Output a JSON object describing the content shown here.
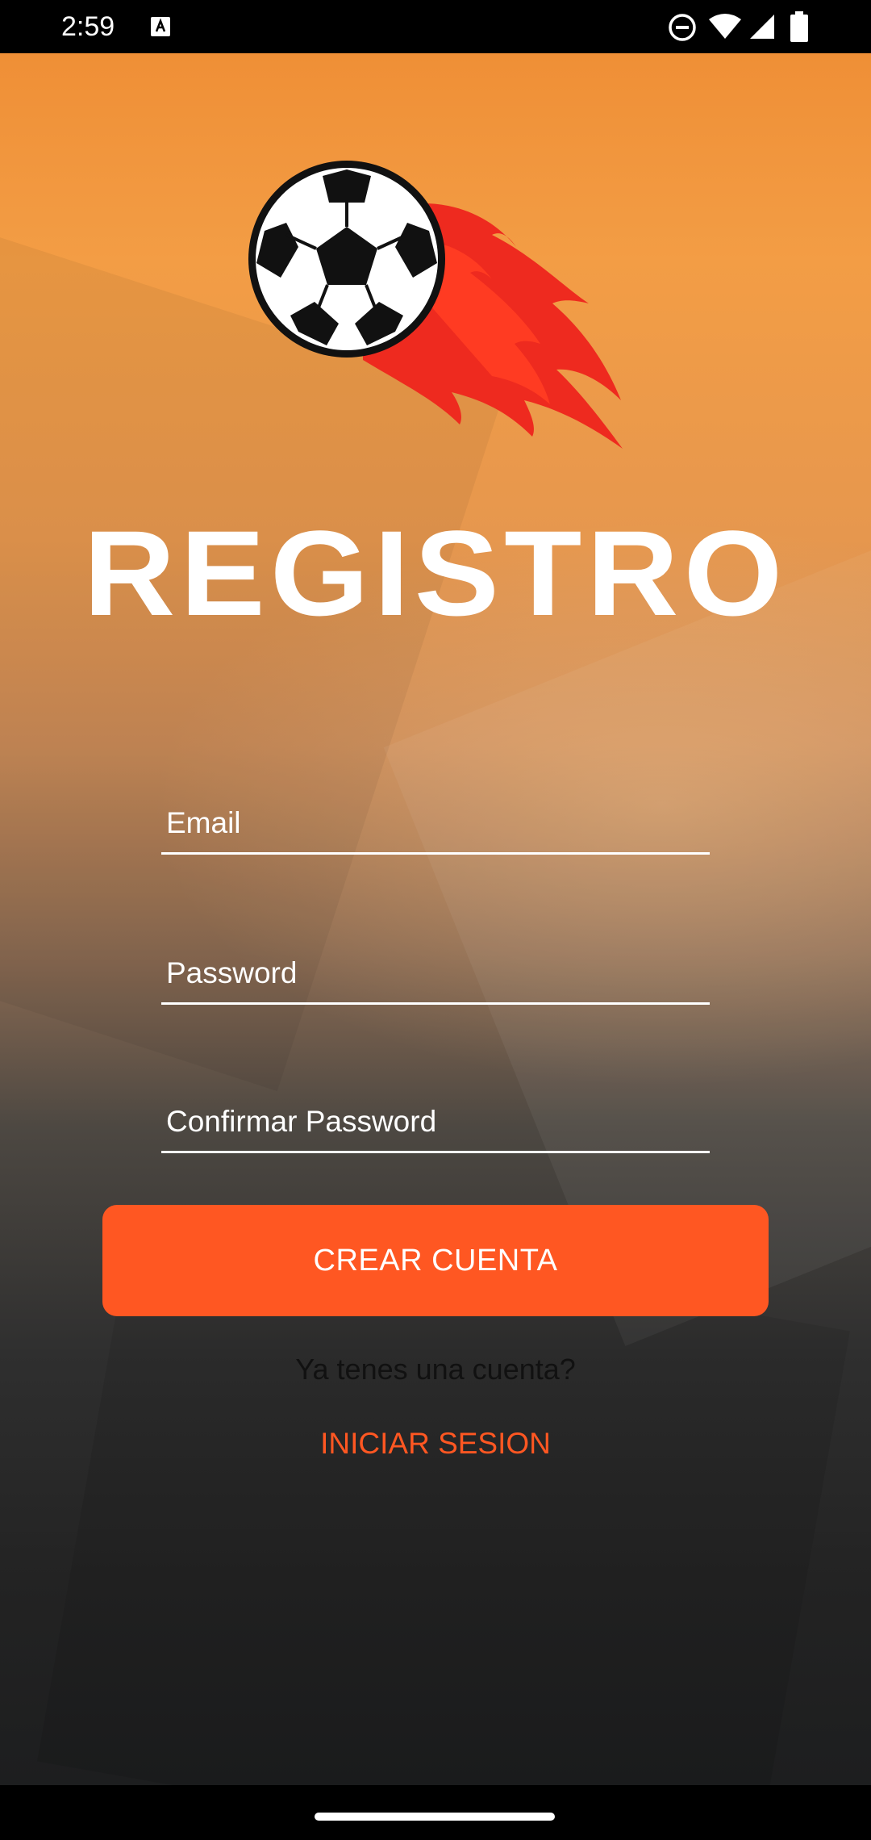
{
  "status_bar": {
    "time": "2:59",
    "icons": [
      "a-notification-icon",
      "do-not-disturb-icon",
      "wifi-icon",
      "signal-icon",
      "battery-icon"
    ]
  },
  "screen": {
    "title": "REGISTRO",
    "logo": "soccer-ball-flame-logo"
  },
  "form": {
    "email_placeholder": "Email",
    "password_placeholder": "Password",
    "confirm_placeholder": "Confirmar Password",
    "create_button": "CREAR CUENTA"
  },
  "footer": {
    "question": "Ya tenes una cuenta?",
    "login_link": "INICIAR SESION"
  },
  "colors": {
    "accent": "#ff5722",
    "background_top": "#ef8f36",
    "background_bottom": "#1d1e1f"
  }
}
